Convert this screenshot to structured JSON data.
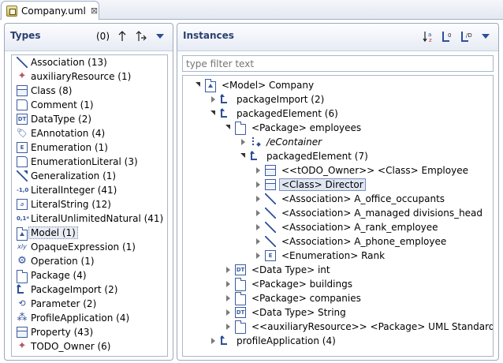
{
  "editor": {
    "tab_title": "Company.uml",
    "close_glyph": "⊠"
  },
  "types_panel": {
    "title": "Types",
    "count": "(0)",
    "items": [
      {
        "label": "Association (13)",
        "icon": "association-icon"
      },
      {
        "label": "auxiliaryResource (1)",
        "icon": "stereotype-icon"
      },
      {
        "label": "Class (8)",
        "icon": "class-icon"
      },
      {
        "label": "Comment (1)",
        "icon": "comment-icon"
      },
      {
        "label": "DataType (2)",
        "icon": "datatype-icon"
      },
      {
        "label": "EAnnotation (4)",
        "icon": "eannotation-icon"
      },
      {
        "label": "Enumeration (1)",
        "icon": "enumeration-icon"
      },
      {
        "label": "EnumerationLiteral (3)",
        "icon": "enumeration-literal-icon"
      },
      {
        "label": "Generalization (1)",
        "icon": "generalization-icon"
      },
      {
        "label": "LiteralInteger (41)",
        "icon": "literal-integer-icon"
      },
      {
        "label": "LiteralString (12)",
        "icon": "literal-string-icon"
      },
      {
        "label": "LiteralUnlimitedNatural (41)",
        "icon": "literal-unlimited-natural-icon"
      },
      {
        "label": "Model (1)",
        "icon": "model-icon",
        "selected": true
      },
      {
        "label": "OpaqueExpression (1)",
        "icon": "opaque-expression-icon"
      },
      {
        "label": "Operation (1)",
        "icon": "operation-icon"
      },
      {
        "label": "Package (4)",
        "icon": "package-icon"
      },
      {
        "label": "PackageImport (2)",
        "icon": "package-import-icon"
      },
      {
        "label": "Parameter (2)",
        "icon": "parameter-icon"
      },
      {
        "label": "ProfileApplication (4)",
        "icon": "profile-application-icon"
      },
      {
        "label": "Property (43)",
        "icon": "property-icon"
      },
      {
        "label": "TODO_Owner (6)",
        "icon": "stereotype-icon"
      }
    ]
  },
  "instances_panel": {
    "title": "Instances",
    "filter_placeholder": "type filter text",
    "tree": [
      {
        "label": "<Model> Company",
        "icon": "model-icon",
        "level": 0,
        "state": "expanded"
      },
      {
        "label": "packageImport (2)",
        "icon": "package-import-icon",
        "level": 1,
        "state": "collapsed"
      },
      {
        "label": "packagedElement (6)",
        "icon": "package-import-icon",
        "level": 1,
        "state": "expanded"
      },
      {
        "label": "<Package> employees",
        "icon": "package-icon",
        "level": 2,
        "state": "expanded"
      },
      {
        "label": "/eContainer",
        "icon": "container-icon",
        "level": 3,
        "state": "collapsed",
        "italic": true
      },
      {
        "label": "packagedElement (7)",
        "icon": "package-import-icon",
        "level": 3,
        "state": "expanded"
      },
      {
        "label": "<<tODO_Owner>> <Class> Employee",
        "icon": "class-icon",
        "level": 4,
        "state": "collapsed"
      },
      {
        "label": "<Class> Director",
        "icon": "class-icon",
        "level": 4,
        "state": "collapsed",
        "selected": true
      },
      {
        "label": "<Association> A_office_occupants",
        "icon": "association-icon",
        "level": 4,
        "state": "collapsed"
      },
      {
        "label": "<Association> A_managed divisions_head",
        "icon": "association-icon",
        "level": 4,
        "state": "collapsed"
      },
      {
        "label": "<Association> A_rank_employee",
        "icon": "association-icon",
        "level": 4,
        "state": "collapsed"
      },
      {
        "label": "<Association> A_phone_employee",
        "icon": "association-icon",
        "level": 4,
        "state": "collapsed"
      },
      {
        "label": "<Enumeration> Rank",
        "icon": "enumeration-icon",
        "level": 4,
        "state": "collapsed"
      },
      {
        "label": "<Data Type> int",
        "icon": "datatype-icon",
        "level": 2,
        "state": "collapsed"
      },
      {
        "label": "<Package> buildings",
        "icon": "package-icon",
        "level": 2,
        "state": "collapsed"
      },
      {
        "label": "<Package> companies",
        "icon": "package-icon",
        "level": 2,
        "state": "collapsed"
      },
      {
        "label": "<Data Type> String",
        "icon": "datatype-icon",
        "level": 2,
        "state": "collapsed"
      },
      {
        "label": "<<auxiliaryResource>> <Package> UML Standard Profile",
        "icon": "package-icon",
        "level": 2,
        "state": "collapsed"
      },
      {
        "label": "profileApplication (4)",
        "icon": "package-import-icon",
        "level": 1,
        "state": "collapsed"
      }
    ]
  },
  "colors": {
    "title_blue": "#2a4170",
    "icon_blue": "#2e4f9a",
    "border": "#9aa8bf"
  }
}
